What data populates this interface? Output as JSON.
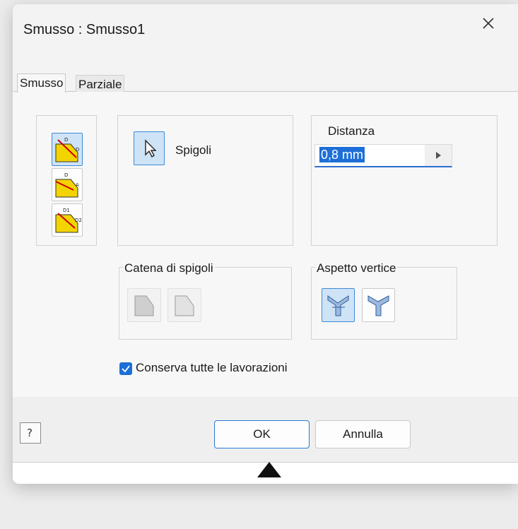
{
  "window": {
    "title": "Smusso : Smusso1",
    "close_icon": "close-icon"
  },
  "tabs": [
    {
      "label": "Smusso",
      "active": true
    },
    {
      "label": "Parziale",
      "active": false
    }
  ],
  "selection": {
    "label": "Spigoli",
    "icon": "pointer-select-icon"
  },
  "distance": {
    "label": "Distanza",
    "value": "0,8 mm",
    "arrow_icon": "play-arrow-icon"
  },
  "edge_chain": {
    "label": "Catena di spigoli"
  },
  "vertex": {
    "label": "Aspetto vertice"
  },
  "preserve": {
    "label": "Conserva tutte le lavorazioni",
    "checked": true
  },
  "buttons": {
    "ok": "OK",
    "cancel": "Annulla"
  },
  "colors": {
    "accent": "#1d6fd6",
    "selected_bg": "#cfe3f6",
    "icon_yellow": "#f3d400"
  }
}
